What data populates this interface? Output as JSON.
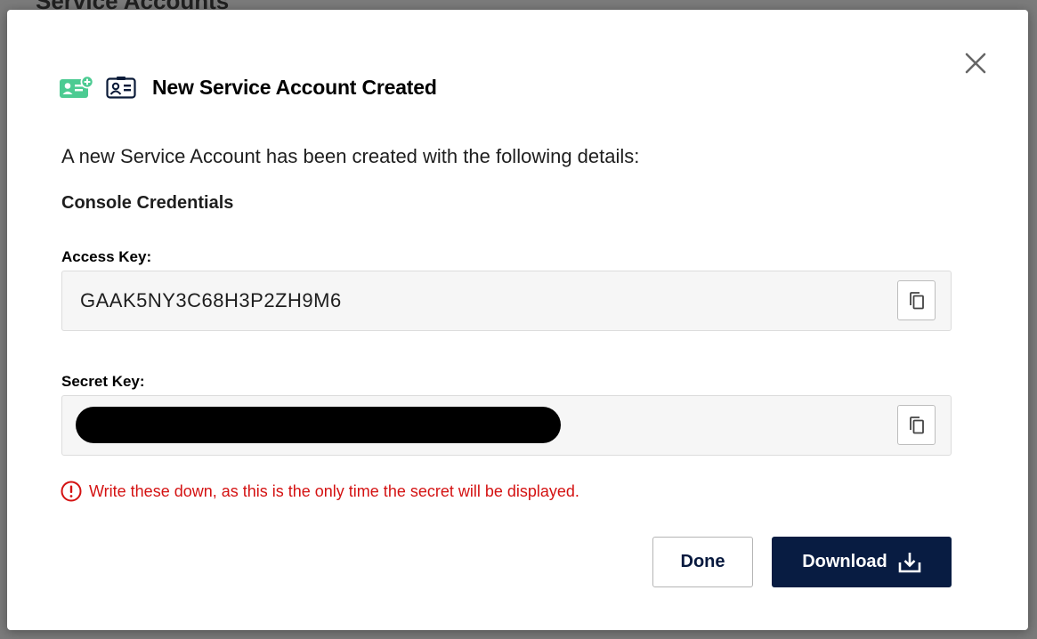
{
  "backdrop": {
    "page_title": "Service Accounts"
  },
  "dialog": {
    "title": "New Service Account Created",
    "intro": "A new Service Account has been created with the following details:",
    "section_title": "Console Credentials",
    "access_key": {
      "label": "Access Key:",
      "value": "GAAK5NY3C68H3P2ZH9M6"
    },
    "secret_key": {
      "label": "Secret Key:",
      "value_redacted": true
    },
    "warning": "Write these down, as this is the only time the secret will be displayed.",
    "buttons": {
      "done": "Done",
      "download": "Download"
    },
    "icons": {
      "header_add": "add-id-card-icon",
      "header_id": "id-card-icon",
      "close": "close-icon",
      "copy": "copy-icon",
      "warning": "alert-circle-icon",
      "download": "download-icon"
    }
  },
  "colors": {
    "accent_green": "#4ccb92",
    "primary_navy": "#081c42",
    "warning_red": "#d41212",
    "field_bg": "#f6f6f6"
  }
}
